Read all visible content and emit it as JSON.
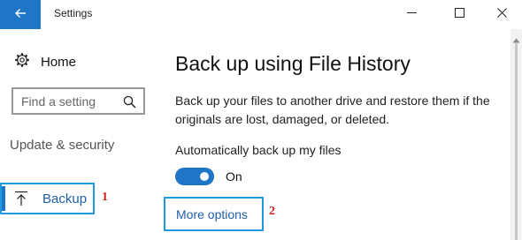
{
  "window": {
    "title": "Settings",
    "back_icon": "arrow-left-icon",
    "controls": [
      "minimize-icon",
      "maximize-icon",
      "close-icon"
    ]
  },
  "sidebar": {
    "home": {
      "icon": "gear-icon",
      "label": "Home"
    },
    "search": {
      "placeholder": "Find a setting",
      "icon": "search-icon"
    },
    "section_label": "Update & security",
    "items": [
      {
        "icon": "backup-upload-icon",
        "label": "Backup",
        "selected": true
      }
    ]
  },
  "main": {
    "title": "Back up using File History",
    "description": "Back up your files to another drive and restore them if the originals are lost, damaged, or deleted.",
    "auto_backup": {
      "label": "Automatically back up my files",
      "state": "On",
      "enabled": true
    },
    "more_options_link": "More options"
  },
  "annotations": {
    "backup_marker": "1",
    "more_options_marker": "2"
  },
  "colors": {
    "accent": "#1f75c6",
    "highlight_box": "#1e9ae0",
    "annotation": "#d21f1f"
  }
}
